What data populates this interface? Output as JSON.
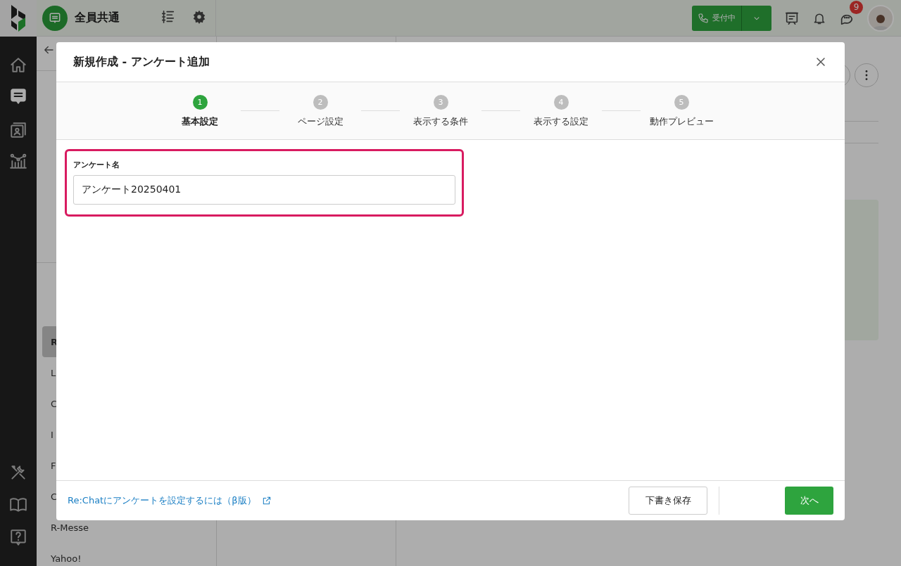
{
  "topbar": {
    "workspace": "全員共通",
    "status_button": "受付中",
    "notification_badge": "9"
  },
  "sidebar": {
    "items": [
      {
        "text": "R",
        "selected": true
      },
      {
        "text": "L",
        "selected": false
      },
      {
        "text": "C",
        "selected": false
      },
      {
        "text": "I",
        "selected": false
      },
      {
        "text": "F",
        "selected": false
      },
      {
        "text": "C",
        "selected": false
      },
      {
        "text": "R-Messe",
        "selected": false
      },
      {
        "text": "Yahoo!",
        "selected": false
      }
    ]
  },
  "modal": {
    "title": "新規作成 - アンケート追加",
    "steps": [
      {
        "number": "1",
        "label": "基本設定",
        "selected": true
      },
      {
        "number": "2",
        "label": "ページ設定",
        "selected": false
      },
      {
        "number": "3",
        "label": "表示する条件",
        "selected": false
      },
      {
        "number": "4",
        "label": "表示する設定",
        "selected": false
      },
      {
        "number": "5",
        "label": "動作プレビュー",
        "selected": false
      }
    ],
    "field": {
      "label": "アンケート名",
      "value": "アンケート20250401"
    },
    "help_link": "Re:Chatにアンケートを設定するには（β版）",
    "buttons": [
      {
        "kind": "secondary",
        "label": "下書き保存"
      },
      {
        "kind": "primary",
        "label": "次へ"
      }
    ]
  }
}
